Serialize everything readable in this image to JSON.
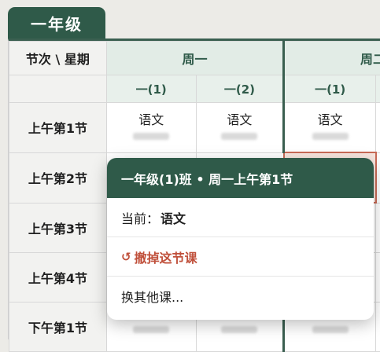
{
  "grade_tab": "一年级",
  "table": {
    "corner": "节次 \\ 星期",
    "days": [
      "周一",
      "周二"
    ],
    "classes": [
      "一(1)",
      "一(2)",
      "一(1)"
    ],
    "periods": [
      {
        "label": "上午第1节",
        "cells": [
          "语文",
          "语文",
          "语文"
        ]
      },
      {
        "label": "上午第2节",
        "cells": [
          "",
          "",
          ""
        ]
      },
      {
        "label": "上午第3节",
        "cells": [
          "",
          "",
          ""
        ]
      },
      {
        "label": "上午第4节",
        "cells": [
          "",
          "",
          ""
        ]
      },
      {
        "label": "下午第1节",
        "cells": [
          "",
          "",
          ""
        ]
      }
    ]
  },
  "popup": {
    "title": "一年级(1)班 • 周一上午第1节",
    "current_label": "当前：",
    "current_value": "语文",
    "remove_icon": "undo-icon",
    "remove_label": "撤掉这节课",
    "swap_label": "换其他课..."
  },
  "colors": {
    "primary": "#2f5a49",
    "danger": "#c0503b",
    "highlight_border": "#c86a56"
  }
}
